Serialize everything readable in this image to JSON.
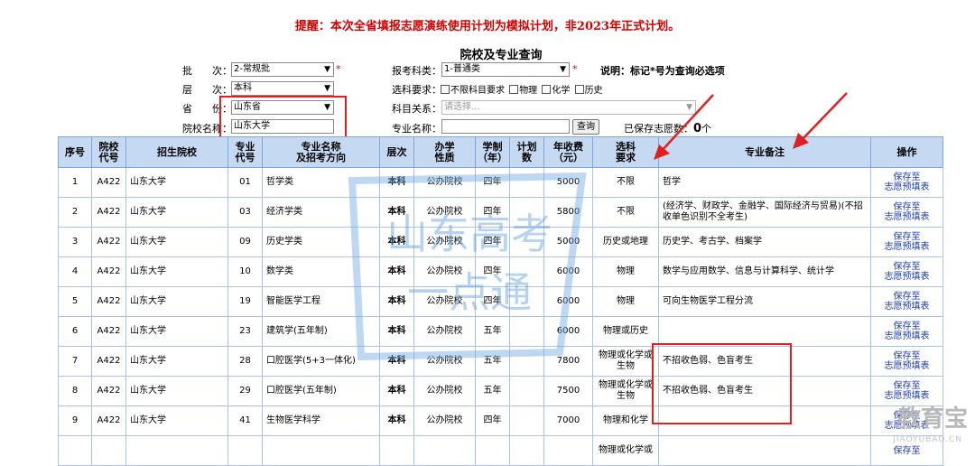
{
  "notice": "提醒：本次全省填报志愿演练使用计划为模拟计划，非2023年正式计划。",
  "page_title": "院校及专业查询",
  "form": {
    "batch_label": "批　　次：",
    "batch_value": "2-常规批",
    "level_label": "层　　次：",
    "level_value": "本科",
    "province_label": "省　　份：",
    "province_value": "山东省",
    "school_label": "院校名称：",
    "school_value": "山东大学",
    "subject_category_label": "报考科类：",
    "subject_category_value": "1-普通类",
    "selection_req_label": "选科要求：",
    "req_options": [
      "不限科目要求",
      "物理",
      "化学",
      "历史"
    ],
    "subject_relation_label": "科目关系：",
    "subject_relation_placeholder": "请选择...",
    "major_name_label": "专业名称：",
    "major_name_value": "",
    "query_button": "查询",
    "note": "说明：标记*号为查询必选项",
    "required_mark": "*",
    "saved_label": "已保存志愿数：",
    "saved_count": "0",
    "saved_unit": "个"
  },
  "table": {
    "headers": [
      "序号",
      "院校\n代号",
      "招生院校",
      "专业\n代号",
      "专业名称\n及招考方向",
      "层次",
      "办学\n性质",
      "学制\n（年）",
      "计划\n数",
      "年收费\n（元）",
      "选科\n要求",
      "专业备注",
      "操作"
    ],
    "rows": [
      {
        "no": "1",
        "code": "A422",
        "school": "山东大学",
        "mcode": "01",
        "major": "哲学类",
        "level": "本科",
        "type": "公办院校",
        "years": "四年",
        "plan": "",
        "fee": "5000",
        "req": "不限",
        "note": "哲学",
        "action": "保存至\n志愿预填表"
      },
      {
        "no": "2",
        "code": "A422",
        "school": "山东大学",
        "mcode": "03",
        "major": "经济学类",
        "level": "本科",
        "type": "公办院校",
        "years": "四年",
        "plan": "",
        "fee": "5800",
        "req": "不限",
        "note": "(经济学、财政学、金融学、国际经济与贸易)(不招收单色识别不全考生)",
        "action": "保存至\n志愿预填表"
      },
      {
        "no": "3",
        "code": "A422",
        "school": "山东大学",
        "mcode": "09",
        "major": "历史学类",
        "level": "本科",
        "type": "公办院校",
        "years": "四年",
        "plan": "",
        "fee": "5000",
        "req": "历史或地理",
        "note": "历史学、考古学、档案学",
        "action": "保存至\n志愿预填表"
      },
      {
        "no": "4",
        "code": "A422",
        "school": "山东大学",
        "mcode": "10",
        "major": "数学类",
        "level": "本科",
        "type": "公办院校",
        "years": "四年",
        "plan": "",
        "fee": "6000",
        "req": "物理",
        "note": "数学与应用数学、信息与计算科学、统计学",
        "action": "保存至\n志愿预填表"
      },
      {
        "no": "5",
        "code": "A422",
        "school": "山东大学",
        "mcode": "19",
        "major": "智能医学工程",
        "level": "本科",
        "type": "公办院校",
        "years": "四年",
        "plan": "",
        "fee": "6000",
        "req": "物理",
        "note": "可向生物医学工程分流",
        "action": "保存至\n志愿预填表"
      },
      {
        "no": "6",
        "code": "A422",
        "school": "山东大学",
        "mcode": "23",
        "major": "建筑学(五年制)",
        "level": "本科",
        "type": "公办院校",
        "years": "五年",
        "plan": "",
        "fee": "6000",
        "req": "物理或历史",
        "note": "",
        "action": "保存至\n志愿预填表"
      },
      {
        "no": "7",
        "code": "A422",
        "school": "山东大学",
        "mcode": "28",
        "major": "口腔医学(5+3一体化)",
        "level": "本科",
        "type": "公办院校",
        "years": "五年",
        "plan": "",
        "fee": "7800",
        "req": "物理或化学或\n生物",
        "note": "不招收色弱、色盲考生",
        "action": "保存至\n志愿预填表"
      },
      {
        "no": "8",
        "code": "A422",
        "school": "山东大学",
        "mcode": "29",
        "major": "口腔医学(五年制)",
        "level": "本科",
        "type": "公办院校",
        "years": "五年",
        "plan": "",
        "fee": "7500",
        "req": "物理或化学或\n生物",
        "note": "不招收色弱、色盲考生",
        "action": "保存至\n志愿预填表"
      },
      {
        "no": "9",
        "code": "A422",
        "school": "山东大学",
        "mcode": "41",
        "major": "生物医学科学",
        "level": "本科",
        "type": "公办院校",
        "years": "四年",
        "plan": "",
        "fee": "7000",
        "req": "物理和化学",
        "note": "",
        "action": "保存至\n志愿预填表"
      },
      {
        "no": "",
        "code": "",
        "school": "",
        "mcode": "",
        "major": "",
        "level": "",
        "type": "",
        "years": "",
        "plan": "",
        "fee": "",
        "req": "物理或化学或",
        "note": "",
        "action": "保存至"
      }
    ]
  },
  "watermark": {
    "line1": "山东高考",
    "line2": "一点通"
  },
  "corner_logo": "教育宝",
  "corner_url": "JIAOYUBAO.CN",
  "colors": {
    "accent_red": "#e02020",
    "header_blue": "#c5d9f3",
    "link_blue": "#1a3bbf"
  }
}
